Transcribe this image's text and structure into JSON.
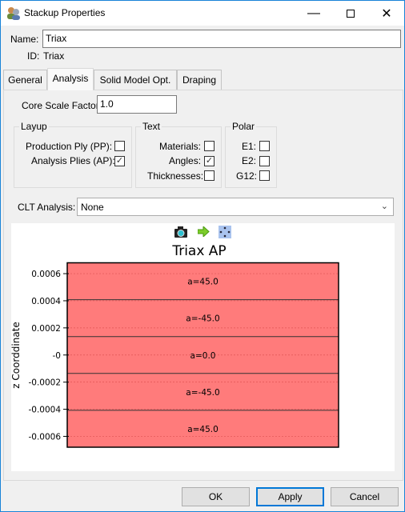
{
  "window": {
    "title": "Stackup Properties",
    "icon": "stackup-users-icon"
  },
  "form": {
    "name_label": "Name:",
    "name_value": "Triax",
    "id_label": "ID:",
    "id_value": "Triax"
  },
  "tabs": [
    {
      "label": "General",
      "selected": false
    },
    {
      "label": "Analysis",
      "selected": true
    },
    {
      "label": "Solid Model Opt.",
      "selected": false
    },
    {
      "label": "Draping",
      "selected": false
    }
  ],
  "analysis": {
    "core_scale_label": "Core Scale Factor:",
    "core_scale_value": "1.0",
    "layup": {
      "title": "Layup",
      "items": [
        {
          "label": "Production Ply (PP):",
          "checked": false
        },
        {
          "label": "Analysis Plies (AP):",
          "checked": true
        }
      ]
    },
    "text": {
      "title": "Text",
      "items": [
        {
          "label": "Materials:",
          "checked": false
        },
        {
          "label": "Angles:",
          "checked": true
        },
        {
          "label": "Thicknesses:",
          "checked": false
        }
      ]
    },
    "polar": {
      "title": "Polar",
      "items": [
        {
          "label": "E1:",
          "checked": false
        },
        {
          "label": "E2:",
          "checked": false
        },
        {
          "label": "G12:",
          "checked": false
        }
      ]
    },
    "clt_label": "CLT Analysis:",
    "clt_value": "None"
  },
  "chart_toolbar": [
    "camera-icon",
    "green-arrow-icon",
    "fit-view-icon"
  ],
  "chart_data": {
    "type": "bar",
    "title": "Triax AP",
    "ylabel": "z Coorddinate",
    "ylim": [
      -0.00068,
      0.00068
    ],
    "yticks": [
      0.0006,
      0.0004,
      0.0002,
      0,
      -0.0002,
      -0.0004,
      -0.0006
    ],
    "ytick_labels": [
      "0.0006",
      "0.0004",
      "0.0002",
      "-0",
      "-0.0002",
      "-0.0004",
      "-0.0006"
    ],
    "grid": true,
    "fill_color": "#ff7b7b",
    "plies": [
      {
        "label": "a=45.0",
        "z_top": 0.00068,
        "z_bottom": 0.000408
      },
      {
        "label": "a=-45.0",
        "z_top": 0.000408,
        "z_bottom": 0.000136
      },
      {
        "label": "a=0.0",
        "z_top": 0.000136,
        "z_bottom": -0.000136
      },
      {
        "label": "a=-45.0",
        "z_top": -0.000136,
        "z_bottom": -0.000408
      },
      {
        "label": "a=45.0",
        "z_top": -0.000408,
        "z_bottom": -0.00068
      }
    ]
  },
  "buttons": {
    "ok": "OK",
    "apply": "Apply",
    "cancel": "Cancel"
  }
}
